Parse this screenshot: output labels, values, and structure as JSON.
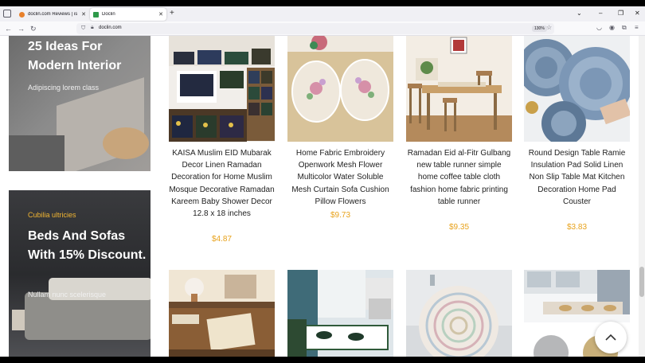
{
  "browser": {
    "tabs": [
      {
        "title": "doclin.com Reviews | is doclin.c",
        "active": false
      },
      {
        "title": "Doclin",
        "active": true
      }
    ],
    "url": "doclin.com",
    "zoom": "130%"
  },
  "banners": [
    {
      "title": "25 Ideas For Modern Interior",
      "subtitle": "Adipiscing lorem class"
    },
    {
      "kicker": "Cubilia ultricies",
      "title": "Beds And Sofas With 15% Discount.",
      "subtitle": "Nullam nunc scelerisque"
    }
  ],
  "products": [
    {
      "name": "KAISA Muslim EID Mubarak Decor Linen Ramadan Decoration for Home Muslim Mosque Decorative Ramadan Kareem Baby Shower Decor 12.8 x 18 inches",
      "price": "$4.87"
    },
    {
      "name": "Home Fabric Embroidery Openwork Mesh Flower Multicolor Water Soluble Mesh Curtain Sofa Cushion Pillow Flowers",
      "price": "$9.73"
    },
    {
      "name": "Ramadan Eid al-Fitr Gulbang new table runner simple home coffee table cloth fashion home fabric printing table runner",
      "price": "$9.35"
    },
    {
      "name": "Round Design Table Ramie Insulation Pad Solid Linen Non Slip Table Mat Kitchen Decoration Home Pad Couster",
      "price": "$3.83"
    }
  ],
  "colors": {
    "price": "#e8a21b",
    "kicker": "#f2b632"
  }
}
